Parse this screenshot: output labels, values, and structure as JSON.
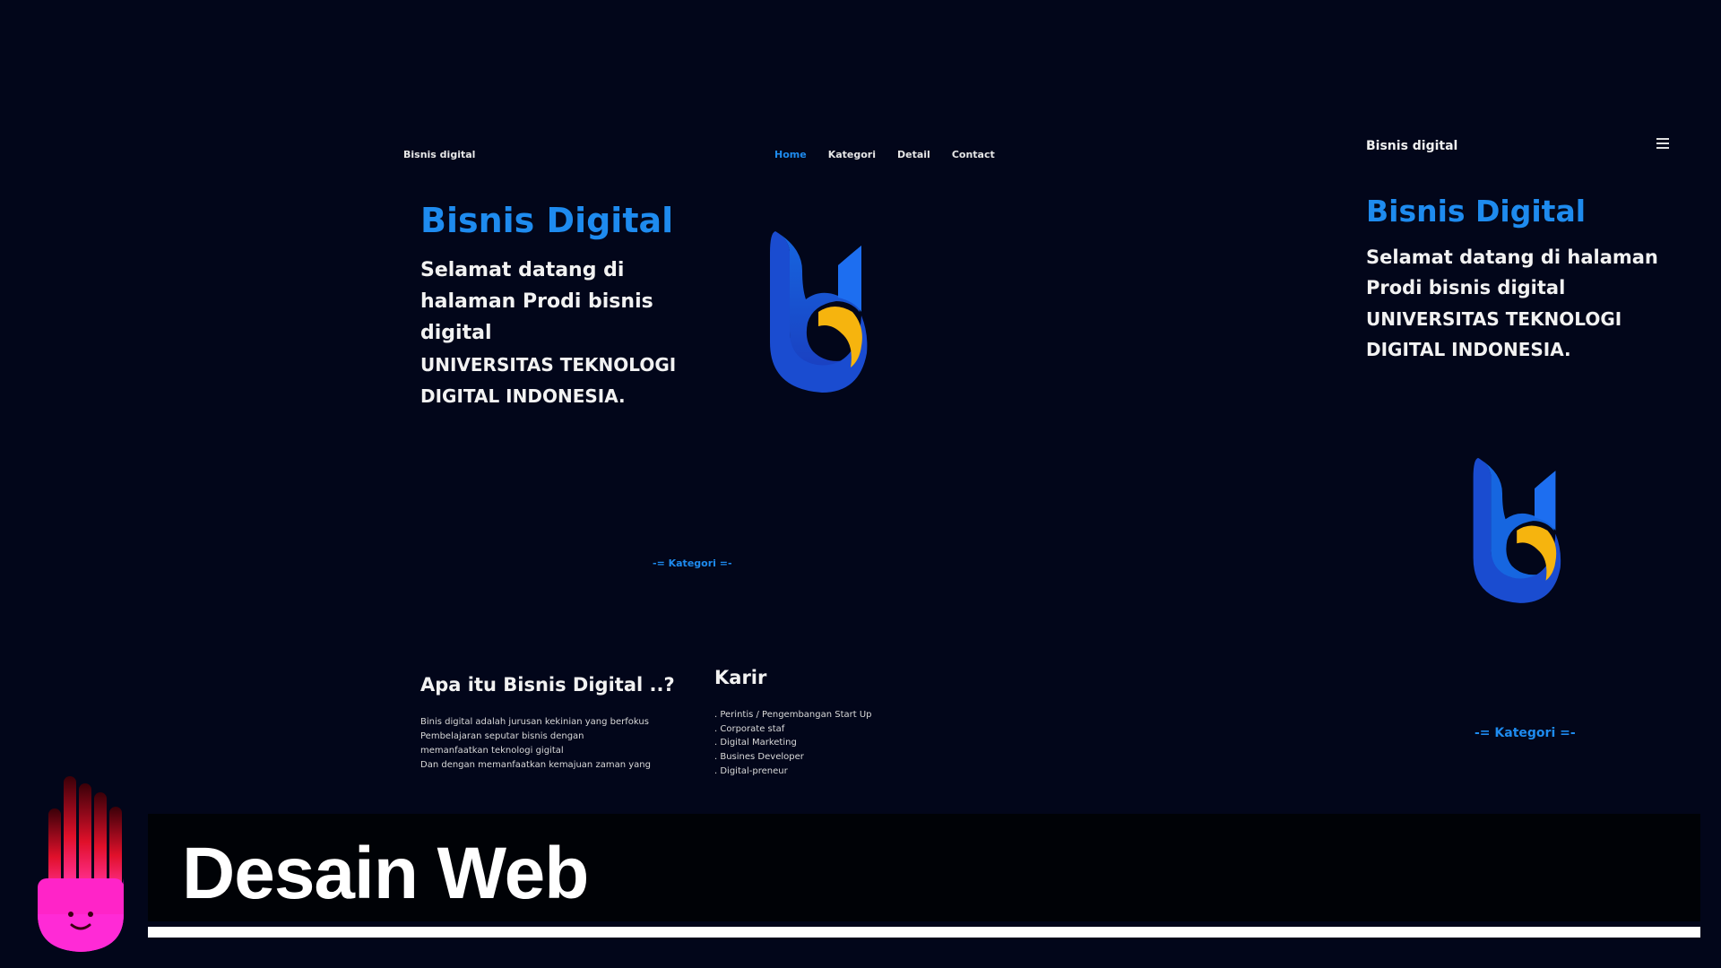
{
  "desktop": {
    "brand": "Bisnis digital",
    "nav": [
      "Home",
      "Kategori",
      "Detail",
      "Contact"
    ],
    "active_nav": "Home",
    "hero": {
      "title": "Bisnis Digital",
      "lead": "Selamat datang di halaman Prodi bisnis digital",
      "university": "UNIVERSITAS TEKNOLOGI DIGITAL INDONESIA."
    },
    "kategori_heading": "-= Kategori =-",
    "about": {
      "heading": "Apa itu Bisnis Digital ..?",
      "lines": [
        "Binis digital adalah jurusan kekinian yang berfokus",
        "Pembelajaran seputar bisnis dengan",
        "memanfaatkan teknologi gigital",
        "Dan dengan memanfaatkan kemajuan zaman yang"
      ]
    },
    "karir": {
      "heading": "Karir",
      "items": [
        ". Perintis / Pengembangan Start Up",
        ". Corporate staf",
        ". Digital Marketing",
        ". Busines Developer",
        ". Digital-preneur"
      ]
    }
  },
  "mobile": {
    "brand": "Bisnis digital",
    "menu_icon": "hamburger-icon",
    "hero": {
      "title": "Bisnis Digital",
      "lead": "Selamat datang di halaman Prodi bisnis digital",
      "university": "UNIVERSITAS TEKNOLOGI DIGITAL INDONESIA."
    },
    "kategori_heading": "-= Kategori =-"
  },
  "banner": {
    "title": "Desain Web"
  },
  "colors": {
    "background": "#02061a",
    "accent": "#1e8bef",
    "logo_blue": "#1a56d6",
    "logo_yellow": "#f6b40e"
  }
}
